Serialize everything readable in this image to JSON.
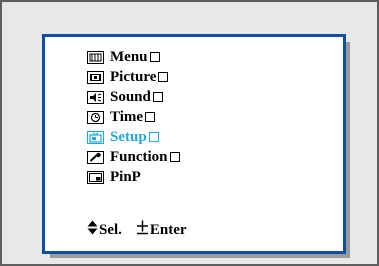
{
  "menu": {
    "items": [
      {
        "label": "Menu",
        "icon": "menu-icon",
        "has_submenu": true
      },
      {
        "label": "Picture",
        "icon": "picture-icon",
        "has_submenu": true
      },
      {
        "label": "Sound",
        "icon": "sound-icon",
        "has_submenu": true
      },
      {
        "label": "Time",
        "icon": "time-icon",
        "has_submenu": true
      },
      {
        "label": "Setup",
        "icon": "setup-icon",
        "has_submenu": true,
        "selected": true
      },
      {
        "label": "Function",
        "icon": "function-icon",
        "has_submenu": true
      },
      {
        "label": "PinP",
        "icon": "pinp-icon",
        "has_submenu": false
      }
    ]
  },
  "hints": {
    "select_icon": "up-down-arrow-icon",
    "select_label": "Sel.",
    "enter_icon": "plus-minus-icon",
    "enter_label": "Enter"
  },
  "colors": {
    "frame_border": "#0c4fa3",
    "selected_text": "#1fa8ea",
    "panel_background": "#ffffff",
    "screen_background": "#e8e8e8"
  }
}
